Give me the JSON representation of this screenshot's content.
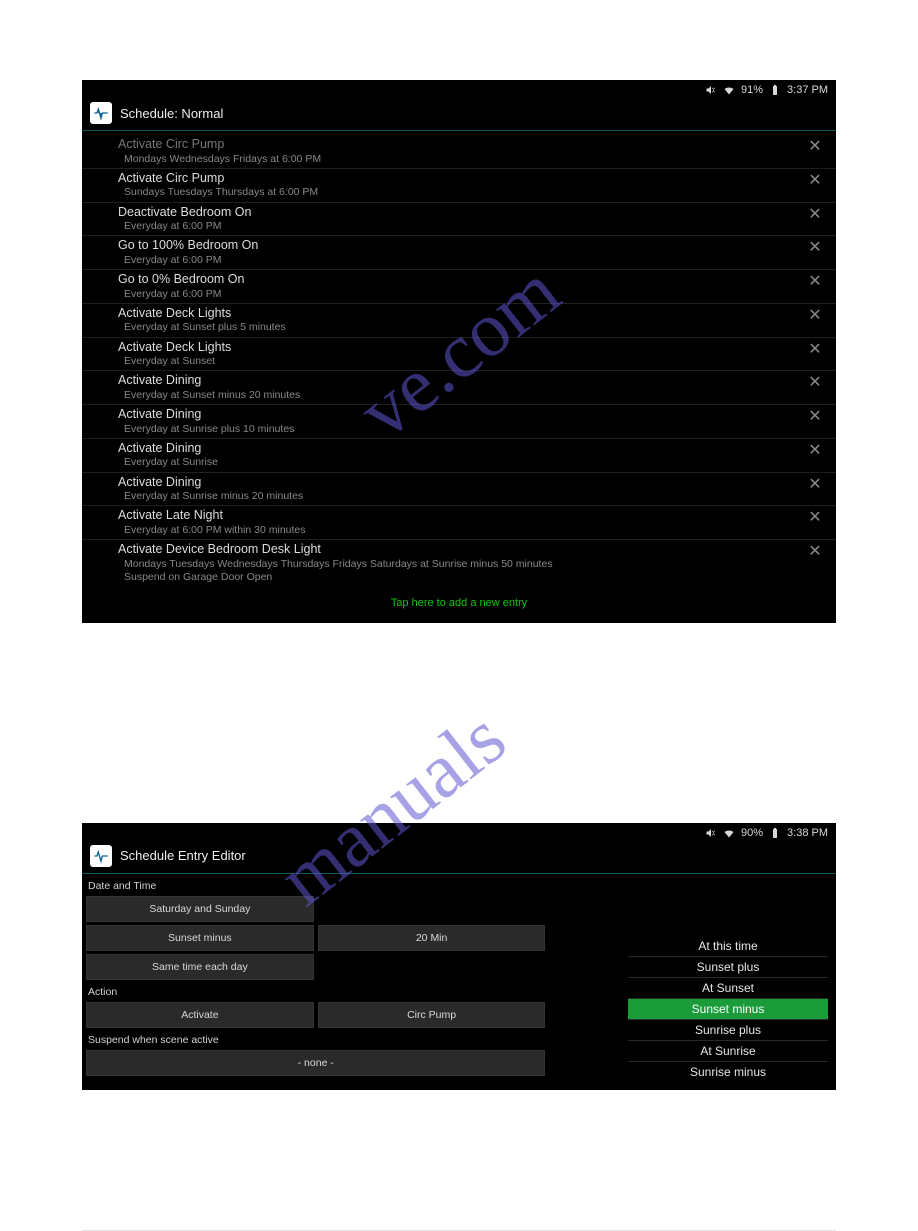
{
  "screen1": {
    "status": {
      "battery": "91%",
      "time": "3:37 PM"
    },
    "title": "Schedule: Normal",
    "entries": [
      {
        "title": "Activate Circ Pump",
        "sub": "Mondays Wednesdays Fridays at 6:00 PM",
        "truncated": true
      },
      {
        "title": "Activate Circ Pump",
        "sub": "Sundays Tuesdays Thursdays at 6:00 PM"
      },
      {
        "title": "Deactivate Bedroom On",
        "sub": "Everyday at 6:00 PM"
      },
      {
        "title": "Go to 100% Bedroom On",
        "sub": "Everyday at 6:00 PM"
      },
      {
        "title": "Go to 0% Bedroom On",
        "sub": "Everyday at 6:00 PM"
      },
      {
        "title": "Activate Deck Lights",
        "sub": "Everyday at Sunset plus 5 minutes"
      },
      {
        "title": "Activate Deck Lights",
        "sub": "Everyday at Sunset"
      },
      {
        "title": "Activate Dining",
        "sub": "Everyday at Sunset minus 20 minutes"
      },
      {
        "title": "Activate Dining",
        "sub": "Everyday at Sunrise plus 10 minutes"
      },
      {
        "title": "Activate Dining",
        "sub": "Everyday at Sunrise"
      },
      {
        "title": "Activate Dining",
        "sub": "Everyday at Sunrise minus 20 minutes"
      },
      {
        "title": "Activate Late Night",
        "sub": "Everyday at 6:00 PM within 30 minutes"
      },
      {
        "title": "Activate Device Bedroom Desk Light",
        "sub": "Mondays Tuesdays Wednesdays Thursdays Fridays Saturdays at Sunrise minus 50 minutes",
        "sub2": "Suspend on Garage Door Open"
      }
    ],
    "add_label": "Tap here to add a new entry",
    "delete_glyph": "✕"
  },
  "screen2": {
    "status": {
      "battery": "90%",
      "time": "3:38 PM"
    },
    "title": "Schedule Entry Editor",
    "sections": {
      "datetime_label": "Date and Time",
      "days_btn": "Saturday and Sunday",
      "time_mode_btn": "Sunset minus",
      "offset_btn": "20 Min",
      "variance_btn": "Same time each day",
      "action_label": "Action",
      "action_btn": "Activate",
      "target_btn": "Circ Pump",
      "suspend_label": "Suspend when scene active",
      "suspend_btn": "- none -"
    },
    "dropdown": {
      "options": [
        "At this time",
        "Sunset plus",
        "At Sunset",
        "Sunset minus",
        "Sunrise plus",
        "At Sunrise",
        "Sunrise minus"
      ],
      "selected": "Sunset minus"
    }
  },
  "watermark": "manualshive.com"
}
